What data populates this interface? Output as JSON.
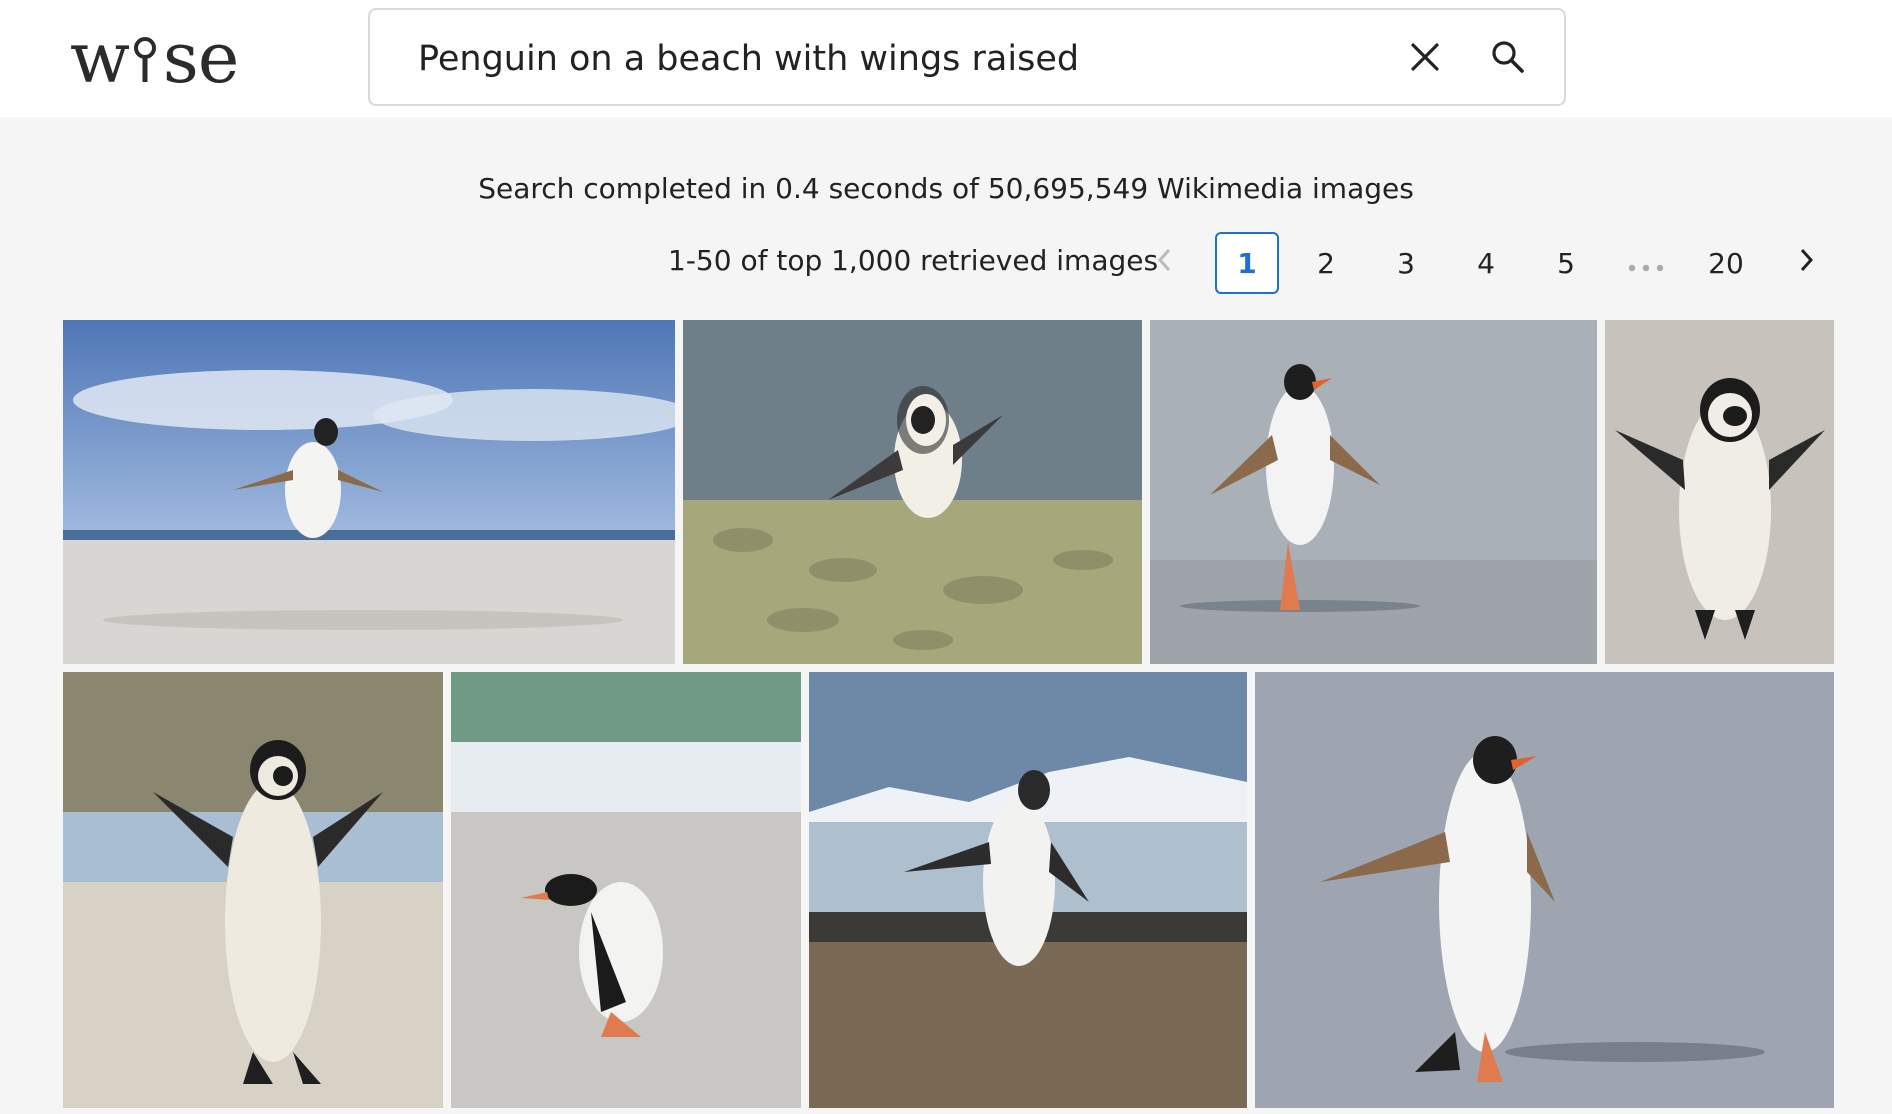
{
  "logo": {
    "text_left": "w",
    "text_right": "se"
  },
  "search": {
    "value": "Penguin on a beach with wings raised"
  },
  "icons": {
    "clear": "close-icon",
    "search": "search-icon",
    "prev": "chevron-left-icon",
    "next": "chevron-right-icon",
    "ellipsis": "more-horizontal-icon"
  },
  "summary": "Search completed in 0.4 seconds of 50,695,549 Wikimedia images",
  "results_range": "1-50 of top 1,000 retrieved images",
  "pagination": {
    "pages": [
      "1",
      "2",
      "3",
      "4",
      "5"
    ],
    "active": "1",
    "last": "20"
  },
  "colors": {
    "accent": "#1f6fd1",
    "background": "#f5f5f5"
  },
  "results": [
    {
      "label": "penguin-image-1"
    },
    {
      "label": "penguin-image-2"
    },
    {
      "label": "penguin-image-3"
    },
    {
      "label": "penguin-image-4"
    },
    {
      "label": "penguin-image-5"
    },
    {
      "label": "penguin-image-6"
    },
    {
      "label": "penguin-image-7"
    },
    {
      "label": "penguin-image-8"
    }
  ]
}
